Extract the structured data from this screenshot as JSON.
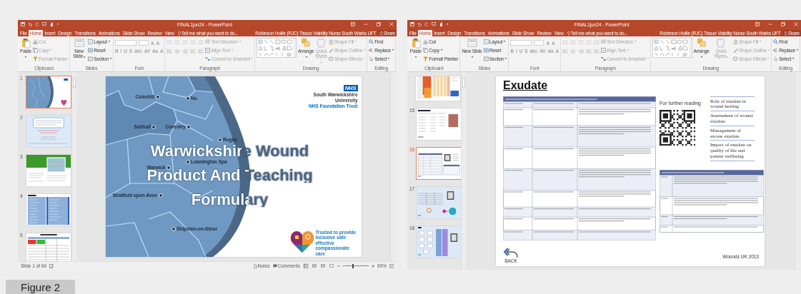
{
  "windows": [
    {
      "title": "FINAL1jun24 - PowerPoint",
      "tabs": [
        {
          "label": "File",
          "selected": false
        },
        {
          "label": "Home",
          "selected": true
        },
        {
          "label": "Insert",
          "selected": false
        },
        {
          "label": "Design",
          "selected": false
        },
        {
          "label": "Transitions",
          "selected": false
        },
        {
          "label": "Animations",
          "selected": false
        },
        {
          "label": "Slide Show",
          "selected": false
        },
        {
          "label": "Review",
          "selected": false
        },
        {
          "label": "View",
          "selected": false
        }
      ],
      "tell_me": "Tell me what you want to do...",
      "user": "Robinson Hollie (RJC) Tissue Viability Nurse South Warks UFT",
      "share": "Share",
      "ribbon": {
        "groups": [
          {
            "label": "Clipboard",
            "parts": [
              {
                "kind": "large",
                "label": "Paste",
                "dropdown": true,
                "disabled": false
              },
              {
                "kind": "stack",
                "items": [
                  {
                    "label": "Cut",
                    "dropdown": false,
                    "disabled": true
                  },
                  {
                    "label": "Copy",
                    "dropdown": true,
                    "disabled": true
                  },
                  {
                    "label": "Format Painter",
                    "dropdown": false,
                    "disabled": true
                  }
                ]
              }
            ]
          },
          {
            "label": "Slides",
            "parts": [
              {
                "kind": "large",
                "label": "New Slide",
                "dropdown": true,
                "disabled": false
              },
              {
                "kind": "stack",
                "items": [
                  {
                    "label": "Layout",
                    "dropdown": true,
                    "disabled": false
                  },
                  {
                    "label": "Reset",
                    "dropdown": false,
                    "disabled": false
                  },
                  {
                    "label": "Section",
                    "dropdown": true,
                    "disabled": false
                  }
                ]
              }
            ]
          },
          {
            "label": "Font",
            "parts": [
              {
                "kind": "font",
                "disabled": true,
                "size_buttons": [
                  "A",
                  "A"
                ],
                "format_buttons": [
                  "B",
                  "I",
                  "U",
                  "S",
                  "abc",
                  "AV",
                  "Aa",
                  "A"
                ]
              }
            ]
          },
          {
            "label": "Paragraph",
            "parts": [
              {
                "kind": "paragraph",
                "disabled": true
              },
              {
                "kind": "stack",
                "items": [
                  {
                    "label": "Text Direction",
                    "dropdown": true,
                    "disabled": true
                  },
                  {
                    "label": "Align Text",
                    "dropdown": true,
                    "disabled": true
                  },
                  {
                    "label": "Convert to SmartArt",
                    "dropdown": true,
                    "disabled": true
                  }
                ]
              }
            ]
          },
          {
            "label": "Drawing",
            "parts": [
              {
                "kind": "gallery"
              },
              {
                "kind": "large",
                "label": "Arrange",
                "dropdown": true,
                "disabled": false
              },
              {
                "kind": "large",
                "label": "Quick Styles",
                "dropdown": true,
                "disabled": true
              },
              {
                "kind": "stack",
                "items": [
                  {
                    "label": "Shape Fill",
                    "dropdown": true,
                    "disabled": true
                  },
                  {
                    "label": "Shape Outline",
                    "dropdown": true,
                    "disabled": true
                  },
                  {
                    "label": "Shape Effects",
                    "dropdown": true,
                    "disabled": true
                  }
                ]
              }
            ]
          },
          {
            "label": "Editing",
            "parts": [
              {
                "kind": "stack",
                "items": [
                  {
                    "label": "Find",
                    "dropdown": false,
                    "disabled": false
                  },
                  {
                    "label": "Replace",
                    "dropdown": true,
                    "disabled": false
                  },
                  {
                    "label": "Select",
                    "dropdown": true,
                    "disabled": false
                  }
                ]
              }
            ]
          }
        ]
      },
      "thumbnails": [
        {
          "number": "1",
          "selected": true,
          "kind": "map-title"
        },
        {
          "number": "2",
          "selected": false,
          "kind": "text-box"
        },
        {
          "number": "3",
          "selected": false,
          "kind": "co2"
        },
        {
          "number": "4",
          "selected": false,
          "kind": "table"
        },
        {
          "number": "5",
          "selected": false,
          "kind": "table-colored"
        }
      ],
      "slide": {
        "kind": "title-map",
        "towns": [
          "Coleshill",
          "Nu",
          "Solihull",
          "Coventry",
          "Rugby",
          "Leamington Spa",
          "Warwick",
          "Stratford upon Avon",
          "Shipston-on-Stour"
        ],
        "title_lines": [
          "Warwickshire Wound",
          "Product And Teaching",
          "Formulary"
        ],
        "logo": {
          "badge": "NHS",
          "org_lines": [
            "South Warwickshire",
            "University"
          ],
          "trust": "NHS Foundation Trust"
        },
        "tagline": "Trusted to provide inclusive safe effective compassionate care"
      },
      "status_bar": {
        "slide_info": "Slide 1 of 64",
        "notes": "Notes",
        "comments": "Comments",
        "views": [
          {
            "selected": true
          },
          {
            "selected": false
          },
          {
            "selected": false
          },
          {
            "selected": false
          }
        ],
        "zoom": {
          "level": 0.37
        },
        "zoom_percent": "69%"
      }
    },
    {
      "title": "FINAL1jun24 - PowerPoint",
      "tabs": [
        {
          "label": "File",
          "selected": false
        },
        {
          "label": "Home",
          "selected": true
        },
        {
          "label": "Insert",
          "selected": false
        },
        {
          "label": "Design",
          "selected": false
        },
        {
          "label": "Transitions",
          "selected": false
        },
        {
          "label": "Animations",
          "selected": false
        },
        {
          "label": "Slide Show",
          "selected": false
        },
        {
          "label": "Review",
          "selected": false
        },
        {
          "label": "View",
          "selected": false
        }
      ],
      "tell_me": "Tell me what you want to do...",
      "user": "Robinson Hollie (RJC) Tissue Viability Nurse South Warks UFT",
      "share": "Share",
      "ribbon": {
        "groups": [
          {
            "label": "Clipboard",
            "parts": [
              {
                "kind": "large",
                "label": "Paste",
                "dropdown": true,
                "disabled": false
              },
              {
                "kind": "stack",
                "items": [
                  {
                    "label": "Cut",
                    "dropdown": false,
                    "disabled": false
                  },
                  {
                    "label": "Copy",
                    "dropdown": true,
                    "disabled": false
                  },
                  {
                    "label": "Format Painter",
                    "dropdown": false,
                    "disabled": false
                  }
                ]
              }
            ]
          },
          {
            "label": "Slides",
            "parts": [
              {
                "kind": "large",
                "label": "New Slide",
                "dropdown": true,
                "disabled": false
              },
              {
                "kind": "stack",
                "items": [
                  {
                    "label": "Layout",
                    "dropdown": true,
                    "disabled": false
                  },
                  {
                    "label": "Reset",
                    "dropdown": false,
                    "disabled": false
                  },
                  {
                    "label": "Section",
                    "dropdown": true,
                    "disabled": false
                  }
                ]
              }
            ]
          },
          {
            "label": "Font",
            "parts": [
              {
                "kind": "font",
                "disabled": true,
                "size_buttons": [
                  "A",
                  "A"
                ],
                "format_buttons": [
                  "B",
                  "I",
                  "U",
                  "S",
                  "abc",
                  "AV",
                  "Aa",
                  "A"
                ]
              }
            ]
          },
          {
            "label": "Paragraph",
            "parts": [
              {
                "kind": "paragraph",
                "disabled": true
              },
              {
                "kind": "stack",
                "items": [
                  {
                    "label": "Text Direction",
                    "dropdown": true,
                    "disabled": true
                  },
                  {
                    "label": "Align Text",
                    "dropdown": true,
                    "disabled": true
                  },
                  {
                    "label": "Convert to SmartArt",
                    "dropdown": true,
                    "disabled": true
                  }
                ]
              }
            ]
          },
          {
            "label": "Drawing",
            "parts": [
              {
                "kind": "gallery"
              },
              {
                "kind": "large",
                "label": "Arrange",
                "dropdown": true,
                "disabled": false
              },
              {
                "kind": "large",
                "label": "Quick Styles",
                "dropdown": true,
                "disabled": true
              },
              {
                "kind": "stack",
                "items": [
                  {
                    "label": "Shape Fill",
                    "dropdown": true,
                    "disabled": true
                  },
                  {
                    "label": "Shape Outline",
                    "dropdown": true,
                    "disabled": true
                  },
                  {
                    "label": "Shape Effects",
                    "dropdown": true,
                    "disabled": true
                  }
                ]
              }
            ]
          },
          {
            "label": "Editing",
            "parts": [
              {
                "kind": "stack",
                "items": [
                  {
                    "label": "Find",
                    "dropdown": false,
                    "disabled": false
                  },
                  {
                    "label": "Replace",
                    "dropdown": true,
                    "disabled": false
                  },
                  {
                    "label": "Select",
                    "dropdown": true,
                    "disabled": false
                  }
                ]
              }
            ]
          }
        ]
      },
      "thumbnails": [
        {
          "selected": false,
          "kind": "chart-cut"
        },
        {
          "number": "15",
          "selected": false,
          "kind": "legs"
        },
        {
          "number": "16",
          "selected": true,
          "kind": "exudate"
        },
        {
          "number": "17",
          "selected": false,
          "kind": "timers"
        },
        {
          "number": "18",
          "selected": false,
          "kind": "flow"
        }
      ],
      "slide": {
        "kind": "exudate",
        "heading": "Exudate",
        "further_reading": {
          "label": "For further reading",
          "topics": [
            "Role of exudate in wound healing",
            "Assessment of wound exudate",
            "Management of excess exudate",
            "Impact of exudate on quality of life and patient wellbeing"
          ]
        },
        "back": "BACK",
        "credit": "Wounds UK 2013"
      }
    }
  ],
  "figure_label": "Figure 2"
}
